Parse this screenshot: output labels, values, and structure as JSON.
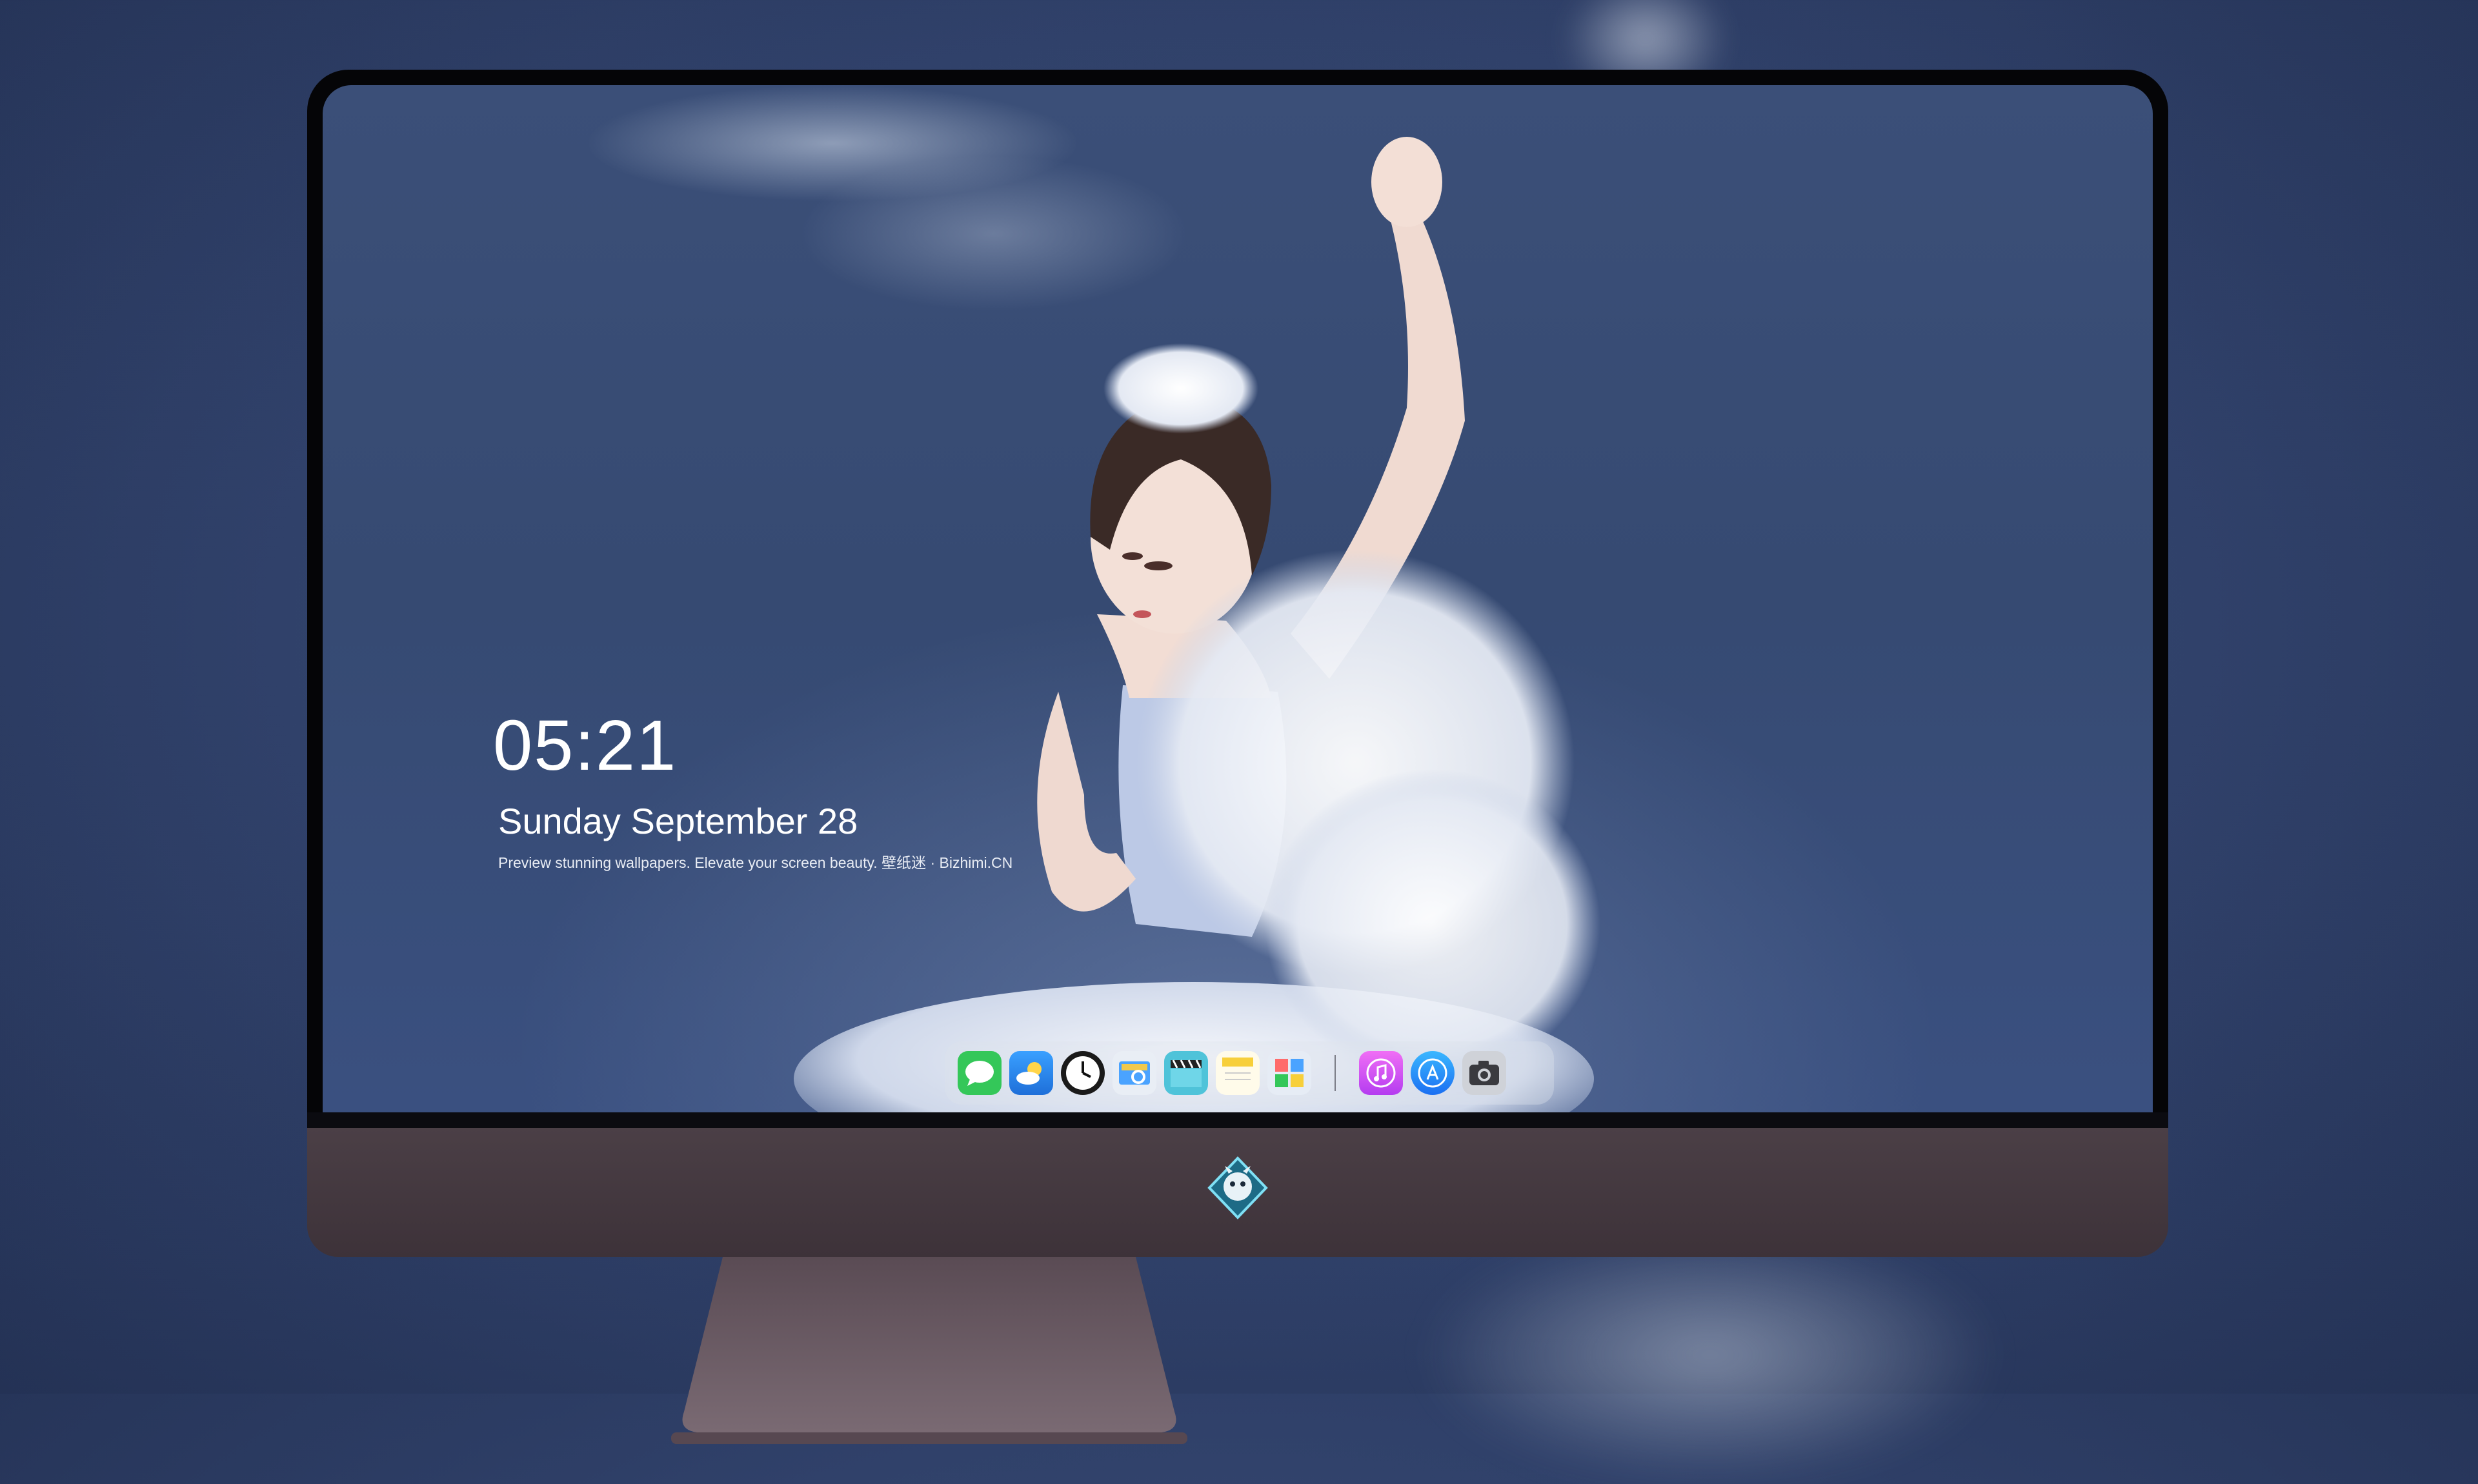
{
  "lockscreen": {
    "time": "05:21",
    "date": "Sunday September  28",
    "tagline": "Preview stunning wallpapers. Elevate your screen beauty. 壁纸迷 · Bizhimi.CN"
  },
  "dock": {
    "items": [
      {
        "name": "messages-icon",
        "color": "#34c759"
      },
      {
        "name": "weather-icon",
        "color": "#1e90ff"
      },
      {
        "name": "clock-icon",
        "color": "#111111"
      },
      {
        "name": "preview-icon",
        "color": "#f2c94c"
      },
      {
        "name": "video-editor-icon",
        "color": "#4fc3d9"
      },
      {
        "name": "notes-icon",
        "color": "#f7d54a"
      },
      {
        "name": "photos-widget-icon",
        "color": "#7fb3ff"
      },
      {
        "name": "music-icon",
        "color": "#d63df2"
      },
      {
        "name": "app-store-icon",
        "color": "#1b8cff"
      },
      {
        "name": "camera-icon",
        "color": "#8e8e93"
      }
    ]
  },
  "monitor": {
    "logo": "dragon-mascot-logo"
  }
}
